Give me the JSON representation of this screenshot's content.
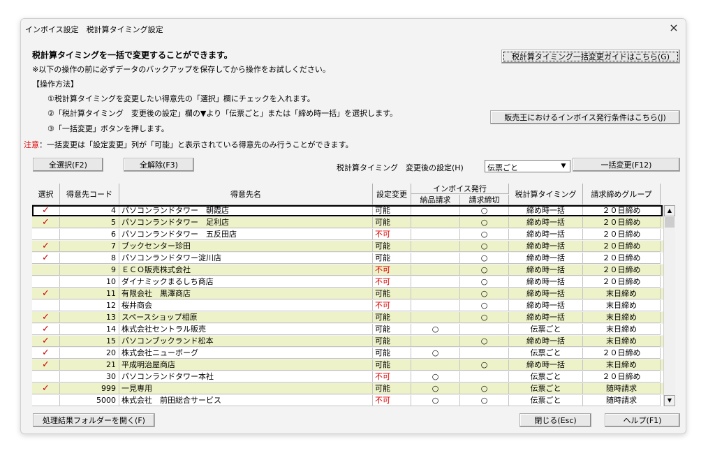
{
  "window": {
    "title": "インボイス設定　税計算タイミング設定",
    "close_label": "×"
  },
  "intro": {
    "heading": "税計算タイミングを一括で変更することができます。",
    "note": "※以下の操作の前に必ずデータのバックアップを保存してから操作をお試しください。",
    "method_title": "【操作方法】",
    "step1": "①税計算タイミングを変更したい得意先の「選択」欄にチェックを入れます。",
    "step2": "②「税計算タイミング　変更後の設定」欄の▼より「伝票ごと」または「締め時一括」を選択します。",
    "step3": "③「一括変更」ボタンを押します。",
    "caution_label": "注意",
    "caution_text": "：一括変更は「設定変更」列が「可能」と表示されている得意先のみ行うことができます。"
  },
  "buttons": {
    "guide": "税計算タイミング一括変更ガイドはこちら(G)",
    "invoice_conditions": "販売王におけるインボイス発行条件はこちら(J)",
    "select_all": "全選択(F2)",
    "deselect_all": "全解除(F3)",
    "bulk_change": "一括変更(F12)",
    "open_folder": "処理結果フォルダーを開く(F)",
    "close": "閉じる(Esc)",
    "help": "ヘルプ(F1)"
  },
  "setting": {
    "label": "税計算タイミング　変更後の設定(H)",
    "value": "伝票ごと"
  },
  "table": {
    "headers": {
      "select": "選択",
      "code": "得意先コード",
      "name": "得意先名",
      "change": "設定変更",
      "invoice_group": "インボイス発行",
      "delivery": "納品請求",
      "billing": "請求締切",
      "timing": "税計算タイミング",
      "group": "請求締めグループ"
    },
    "check_mark": "✓",
    "circle": "○",
    "rows": [
      {
        "sel": true,
        "code": "4",
        "name": "パソコンランドタワー　朝霞店",
        "chg": "可能",
        "d": "",
        "b": "○",
        "tim": "締め時一括",
        "grp": "２０日締め",
        "hl": false
      },
      {
        "sel": true,
        "code": "5",
        "name": "パソコンランドタワー　足利店",
        "chg": "可能",
        "d": "",
        "b": "○",
        "tim": "締め時一括",
        "grp": "２０日締め",
        "hl": true
      },
      {
        "sel": false,
        "code": "6",
        "name": "パソコンランドタワー　五反田店",
        "chg": "不可",
        "d": "",
        "b": "○",
        "tim": "締め時一括",
        "grp": "２０日締め",
        "hl": false
      },
      {
        "sel": true,
        "code": "7",
        "name": "ブックセンター珍田",
        "chg": "可能",
        "d": "",
        "b": "○",
        "tim": "締め時一括",
        "grp": "２０日締め",
        "hl": true
      },
      {
        "sel": true,
        "code": "8",
        "name": "パソコンランドタワー淀川店",
        "chg": "可能",
        "d": "",
        "b": "○",
        "tim": "締め時一括",
        "grp": "２０日締め",
        "hl": false
      },
      {
        "sel": false,
        "code": "9",
        "name": "ＥＣＯ販売株式会社",
        "chg": "不可",
        "d": "",
        "b": "○",
        "tim": "締め時一括",
        "grp": "２０日締め",
        "hl": true
      },
      {
        "sel": false,
        "code": "10",
        "name": "ダイナミックまるしち商店",
        "chg": "不可",
        "d": "",
        "b": "○",
        "tim": "締め時一括",
        "grp": "２０日締め",
        "hl": false
      },
      {
        "sel": true,
        "code": "11",
        "name": "有限会社　黒澤商店",
        "chg": "可能",
        "d": "",
        "b": "○",
        "tim": "締め時一括",
        "grp": "末日締め",
        "hl": true
      },
      {
        "sel": false,
        "code": "12",
        "name": "桜井商会",
        "chg": "不可",
        "d": "",
        "b": "○",
        "tim": "締め時一括",
        "grp": "末日締め",
        "hl": false
      },
      {
        "sel": true,
        "code": "13",
        "name": "スペースショップ相原",
        "chg": "可能",
        "d": "",
        "b": "○",
        "tim": "締め時一括",
        "grp": "末日締め",
        "hl": true
      },
      {
        "sel": true,
        "code": "14",
        "name": "株式会社セントラル販売",
        "chg": "可能",
        "d": "○",
        "b": "",
        "tim": "伝票ごと",
        "grp": "末日締め",
        "hl": false
      },
      {
        "sel": true,
        "code": "15",
        "name": "パソコンブックランド松本",
        "chg": "可能",
        "d": "",
        "b": "○",
        "tim": "締め時一括",
        "grp": "末日締め",
        "hl": true
      },
      {
        "sel": true,
        "code": "20",
        "name": "株式会社ニューボーグ",
        "chg": "可能",
        "d": "○",
        "b": "",
        "tim": "伝票ごと",
        "grp": "２０日締め",
        "hl": false
      },
      {
        "sel": true,
        "code": "21",
        "name": "平成明治屋商店",
        "chg": "可能",
        "d": "",
        "b": "○",
        "tim": "締め時一括",
        "grp": "末日締め",
        "hl": true
      },
      {
        "sel": false,
        "code": "30",
        "name": "パソコンランドタワー本社",
        "chg": "不可",
        "d": "○",
        "b": "",
        "tim": "伝票ごと",
        "grp": "２０日締め",
        "hl": false
      },
      {
        "sel": true,
        "code": "999",
        "name": "一見専用",
        "chg": "可能",
        "d": "○",
        "b": "○",
        "tim": "伝票ごと",
        "grp": "随時請求",
        "hl": true
      },
      {
        "sel": false,
        "code": "5000",
        "name": "株式会社　前田総合サービス",
        "chg": "不可",
        "d": "○",
        "b": "○",
        "tim": "伝票ごと",
        "grp": "随時請求",
        "hl": false
      }
    ]
  },
  "scrollbar": {
    "up": "▲",
    "down": "▼"
  },
  "colors": {
    "row_highlight": "#eef2c8",
    "row_default": "#ffffff",
    "not_allowed": "#e00000",
    "check": "#cc0000"
  }
}
